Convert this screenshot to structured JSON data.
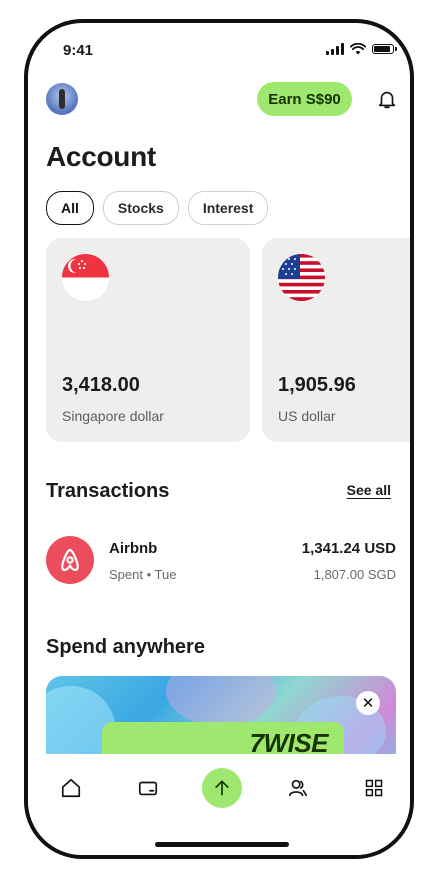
{
  "status_bar": {
    "time": "9:41"
  },
  "header": {
    "earn_label": "Earn S$90"
  },
  "page_title": "Account",
  "filters": [
    {
      "label": "All",
      "active": true
    },
    {
      "label": "Stocks",
      "active": false
    },
    {
      "label": "Interest",
      "active": false
    }
  ],
  "accounts": [
    {
      "amount": "3,418.00",
      "currency": "Singapore dollar",
      "flag": "singapore-flag"
    },
    {
      "amount": "1,905.96",
      "currency": "US dollar",
      "flag": "us-flag"
    }
  ],
  "transactions": {
    "title": "Transactions",
    "see_all": "See all",
    "items": [
      {
        "name": "Airbnb",
        "subtitle": "Spent • Tue",
        "amount": "1,341.24 USD",
        "converted": "1,807.00 SGD",
        "icon": "airbnb-logo-icon"
      }
    ]
  },
  "spend": {
    "title": "Spend anywhere",
    "brand": "7WISE",
    "close_icon": "close-icon"
  },
  "nav": {
    "items": [
      "home-icon",
      "card-icon",
      "send-icon",
      "recipients-icon",
      "hub-icon"
    ]
  },
  "colors": {
    "accent": "#9fe870",
    "airbnb": "#eb4d5c",
    "card_bg": "#eeeeec"
  }
}
